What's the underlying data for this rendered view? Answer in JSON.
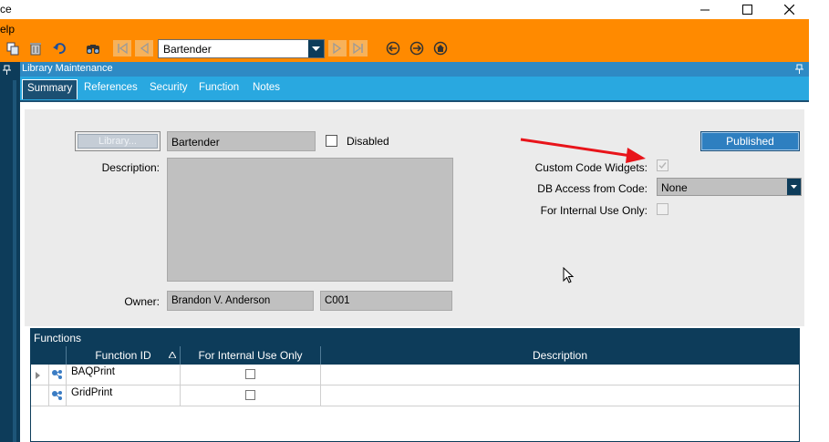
{
  "window": {
    "title_fragment": "ce"
  },
  "menu": {
    "help_fragment": "elp"
  },
  "toolbar": {
    "icons": [
      "copy-icon",
      "delete-icon",
      "undo-icon",
      "search-icon",
      "first-record-icon",
      "previous-record-icon",
      "next-record-icon",
      "last-record-icon",
      "back-icon",
      "forward-icon",
      "home-icon"
    ],
    "record_value": "Bartender"
  },
  "panel": {
    "title": "Library Maintenance"
  },
  "tabs": [
    "Summary",
    "References",
    "Security",
    "Function",
    "Notes"
  ],
  "form": {
    "library_button": "Library...",
    "library_id": "Bartender",
    "disabled_label": "Disabled",
    "description_label": "Description:",
    "description_value": "",
    "owner_label": "Owner:",
    "owner_name": "Brandon V. Anderson",
    "owner_company": "C001",
    "published_button": "Published",
    "custom_code_label": "Custom Code Widgets:",
    "db_access_label": "DB Access from Code:",
    "db_access_value": "None",
    "internal_use_label": "For Internal Use Only:"
  },
  "grid": {
    "title": "Functions",
    "columns": [
      "Function ID",
      "For Internal Use Only",
      "Description"
    ],
    "rows": [
      {
        "function_id": "BAQPrint",
        "internal": false,
        "description": ""
      },
      {
        "function_id": "GridPrint",
        "internal": false,
        "description": ""
      }
    ]
  },
  "colors": {
    "toolbar_orange": "#ff8a00",
    "navy": "#0d3c5a",
    "tab_blue": "#29a8e0",
    "annotation_red": "#e8141a"
  }
}
